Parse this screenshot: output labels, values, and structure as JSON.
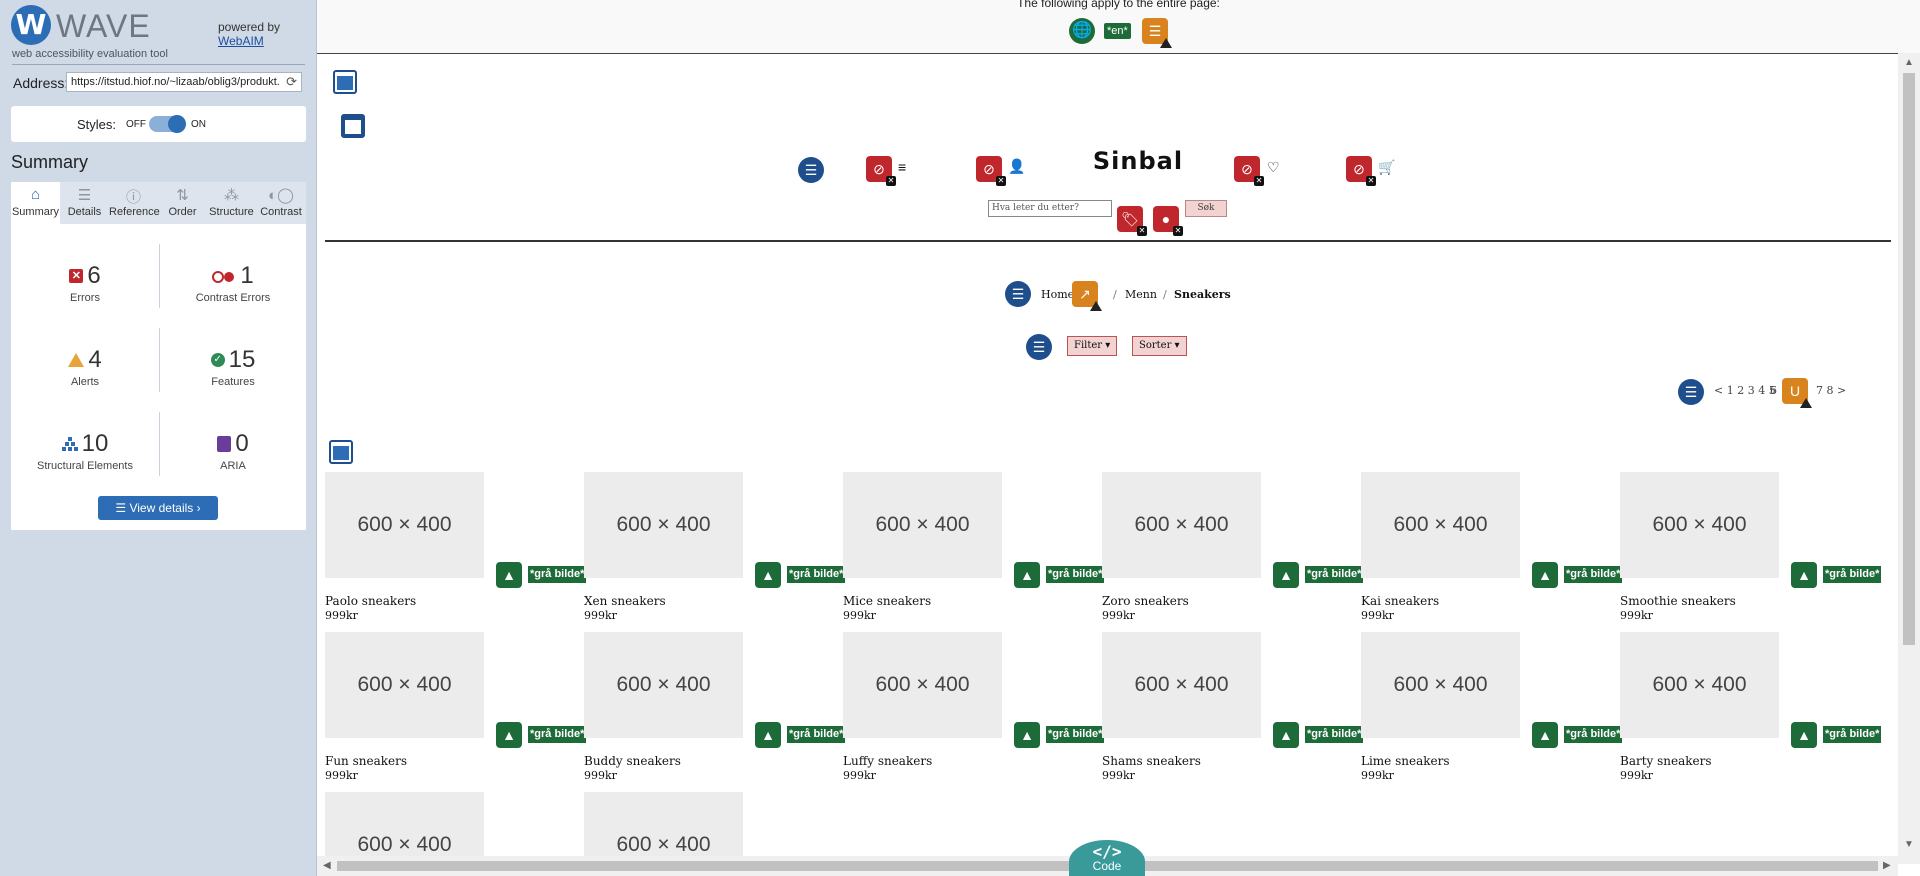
{
  "wave": {
    "logo_letter": "W",
    "wordmark": "WAVE",
    "tagline": "web accessibility evaluation tool",
    "powered_by": "powered by",
    "webaim": "WebAIM",
    "address_label": "Address:",
    "address_value": "https://itstud.hiof.no/~lizaab/oblig3/produkt.",
    "styles_label": "Styles:",
    "styles_off": "OFF",
    "styles_on": "ON",
    "summary_title": "Summary",
    "tabs": [
      {
        "label": "Summary",
        "icon": "home-icon"
      },
      {
        "label": "Details",
        "icon": "list-icon"
      },
      {
        "label": "Reference",
        "icon": "info-icon"
      },
      {
        "label": "Order",
        "icon": "order-icon"
      },
      {
        "label": "Structure",
        "icon": "structure-icon"
      },
      {
        "label": "Contrast",
        "icon": "contrast-icon"
      }
    ],
    "stats": {
      "errors": {
        "count": "6",
        "label": "Errors"
      },
      "contrast_errors": {
        "count": "1",
        "label": "Contrast Errors"
      },
      "alerts": {
        "count": "4",
        "label": "Alerts"
      },
      "features": {
        "count": "15",
        "label": "Features"
      },
      "structural": {
        "count": "10",
        "label": "Structural Elements"
      },
      "aria": {
        "count": "0",
        "label": "ARIA"
      }
    },
    "view_details": "View details ›",
    "colors": {
      "accent": "#2c6db5",
      "error": "#c0272d",
      "alert": "#e8a33a",
      "feature": "#2e8b57",
      "aria": "#6a3d9a"
    }
  },
  "page": {
    "topbar_text": "The following apply to the entire page:",
    "lang_badge": "*en*",
    "brand": "Sinbal",
    "search_placeholder": "Hva leter du etter?",
    "search_button": "Søk",
    "breadcrumb": {
      "home": "Home",
      "sep": "/",
      "middle": "Menn",
      "current": "Sneakers"
    },
    "filter": "Filter ▾",
    "sort": "Sorter ▾",
    "pager": {
      "before": "< 1 2 3 4 5",
      "current": "6",
      "after": "7 8 >",
      "u_icon": "U"
    },
    "image_placeholder": "600 × 400",
    "alt_text": "*grå bilde*",
    "products": [
      {
        "name": "Paolo sneakers",
        "price": "999kr"
      },
      {
        "name": "Xen sneakers",
        "price": "999kr"
      },
      {
        "name": "Mice sneakers",
        "price": "999kr"
      },
      {
        "name": "Zoro sneakers",
        "price": "999kr"
      },
      {
        "name": "Kai sneakers",
        "price": "999kr"
      },
      {
        "name": "Smoothie sneakers",
        "price": "999kr"
      },
      {
        "name": "Fun sneakers",
        "price": "999kr"
      },
      {
        "name": "Buddy sneakers",
        "price": "999kr"
      },
      {
        "name": "Luffy sneakers",
        "price": "999kr"
      },
      {
        "name": "Shams sneakers",
        "price": "999kr"
      },
      {
        "name": "Lime sneakers",
        "price": "999kr"
      },
      {
        "name": "Barty sneakers",
        "price": "999kr"
      }
    ],
    "code_tab": {
      "symbol": "</>",
      "label": "Code"
    }
  }
}
